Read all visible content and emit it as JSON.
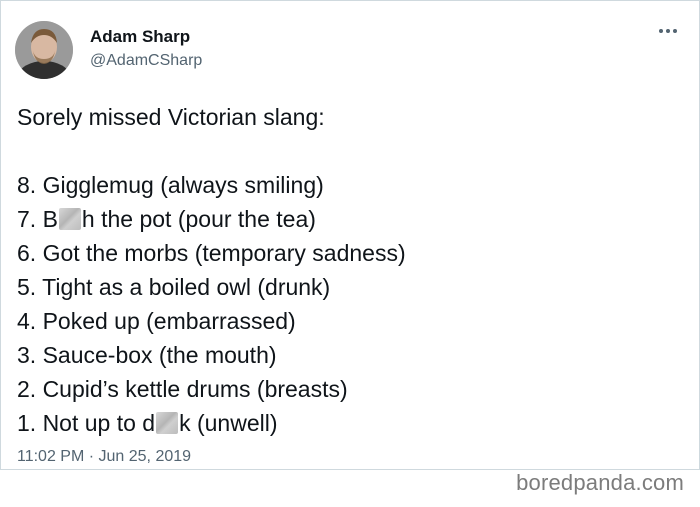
{
  "author": {
    "name": "Adam Sharp",
    "handle": "@AdamCSharp"
  },
  "tweet": {
    "intro": "Sorely missed Victorian slang:",
    "items": [
      "8. Gigglemug (always smiling)",
      {
        "prefix": "7. B",
        "suffix": "h the pot (pour the tea)"
      },
      "6. Got the morbs (temporary sadness)",
      "5. Tight as a boiled owl (drunk)",
      "4. Poked up (embarrassed)",
      "3. Sauce-box (the mouth)",
      "2. Cupid’s kettle drums (breasts)",
      {
        "prefix": "1. Not up to d",
        "suffix": "k (unwell)"
      }
    ],
    "timestamp": "11:02 PM · Jun 25, 2019"
  },
  "watermark": "boredpanda.com",
  "icons": {
    "avatar": "profile-photo",
    "more": "more-options-icon"
  }
}
